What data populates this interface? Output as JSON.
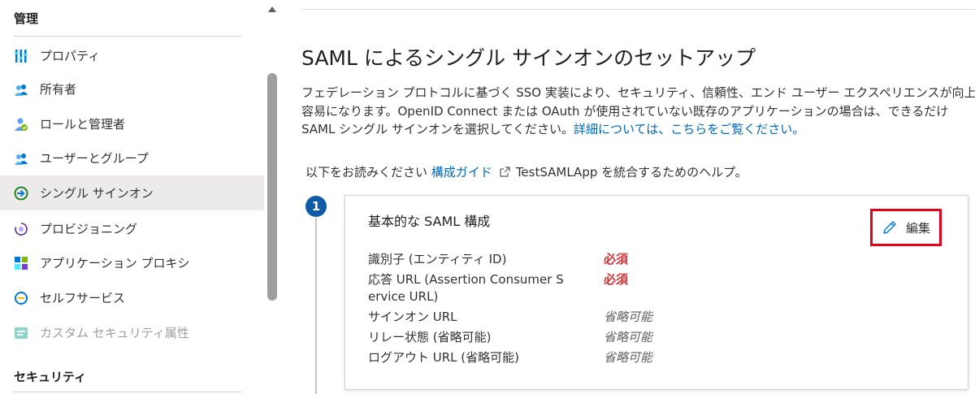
{
  "sidebar": {
    "section_manage": "管理",
    "section_security": "セキュリティ",
    "items": [
      {
        "label": "プロパティ",
        "icon": "properties-icon"
      },
      {
        "label": "所有者",
        "icon": "owners-icon"
      },
      {
        "label": "ロールと管理者",
        "icon": "roles-admins-icon"
      },
      {
        "label": "ユーザーとグループ",
        "icon": "users-groups-icon"
      },
      {
        "label": "シングル サインオン",
        "icon": "single-sign-on-icon",
        "selected": true
      },
      {
        "label": "プロビジョニング",
        "icon": "provisioning-icon"
      },
      {
        "label": "アプリケーション プロキシ",
        "icon": "app-proxy-icon"
      },
      {
        "label": "セルフサービス",
        "icon": "self-service-icon"
      },
      {
        "label": "カスタム セキュリティ属性",
        "icon": "custom-security-attributes-icon",
        "disabled": true
      }
    ]
  },
  "main": {
    "title": "SAML によるシングル サインオンのセットアップ",
    "intro_line1": "フェデレーション プロトコルに基づく SSO 実装により、セキュリティ、信頼性、エンド ユーザー エクスペリエンスが向上し、実装が",
    "intro_line2": "容易になります。OpenID Connect または OAuth が使用されていない既存のアプリケーションの場合は、できるだけ",
    "intro_line3_text": "SAML シングル サインオンを選択してください。",
    "intro_line3_link": "詳細については、こちらをご覧ください。",
    "guide_prefix": "以下をお読みください",
    "guide_link": "構成ガイド",
    "guide_suffix": "TestSAMLApp を統合するためのヘルプ。"
  },
  "step": {
    "number": "1",
    "card_title": "基本的な SAML 構成",
    "edit_label": "編集",
    "fields": [
      {
        "label": "識別子 (エンティティ ID)",
        "value": "必須",
        "status": "required"
      },
      {
        "label": "応答 URL (Assertion Consumer S",
        "label_cont": "ervice URL)",
        "value": "必須",
        "status": "required"
      },
      {
        "label": "サインオン URL",
        "value": "省略可能",
        "status": "optional"
      },
      {
        "label": "リレー状態 (省略可能)",
        "value": "省略可能",
        "status": "optional"
      },
      {
        "label": "ログアウト URL (省略可能)",
        "value": "省略可能",
        "status": "optional"
      }
    ]
  },
  "colors": {
    "accent": "#0067b8",
    "required": "#d13438",
    "highlight_box": "#e3001b",
    "selected_bg": "#edebe9"
  }
}
